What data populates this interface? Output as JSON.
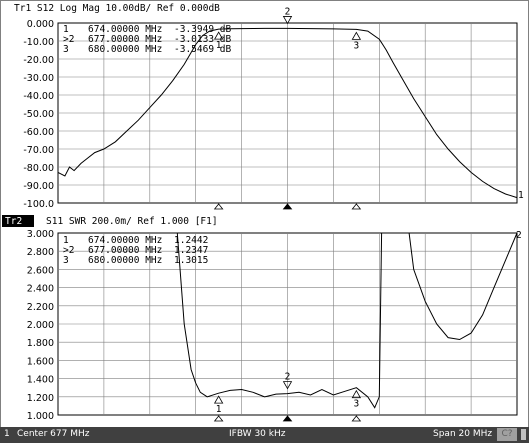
{
  "trace1": {
    "header": "Tr1  S12  Log Mag  10.00dB/  Ref 0.000dB",
    "y_tick_labels": [
      "0.000",
      "-10.00",
      "-20.00",
      "-30.00",
      "-40.00",
      "-50.00",
      "-60.00",
      "-70.00",
      "-80.00",
      "-90.00",
      "-100.0"
    ],
    "markers": [
      {
        "prefix": " ",
        "num": "1",
        "freq": "674.00000 MHz",
        "value": "-3.3949 dB"
      },
      {
        "prefix": ">",
        "num": "2",
        "freq": "677.00000 MHz",
        "value": "-3.0133 dB"
      },
      {
        "prefix": " ",
        "num": "3",
        "freq": "680.00000 MHz",
        "value": "-3.5469 dB"
      }
    ],
    "end_marker_label": "1"
  },
  "trace2": {
    "tag": "Tr2",
    "header": "S11  SWR  200.0m/  Ref 1.000  [F1]",
    "y_tick_labels": [
      "3.000",
      "2.800",
      "2.600",
      "2.400",
      "2.200",
      "2.000",
      "1.800",
      "1.600",
      "1.400",
      "1.200",
      "1.000"
    ],
    "markers": [
      {
        "prefix": " ",
        "num": "1",
        "freq": "674.00000 MHz",
        "value": "1.2442"
      },
      {
        "prefix": ">",
        "num": "2",
        "freq": "677.00000 MHz",
        "value": "1.2347"
      },
      {
        "prefix": " ",
        "num": "3",
        "freq": "680.00000 MHz",
        "value": "1.3015"
      }
    ],
    "end_marker_label": "2"
  },
  "status_bar": {
    "channel": "1",
    "center": "Center 677 MHz",
    "ifbw": "IFBW 30 kHz",
    "span": "Span 20 MHz",
    "cc": "C?"
  },
  "colors": {
    "trace": "#000000",
    "grid": "#808080",
    "background": "#ffffff",
    "status_bar": "#404040"
  },
  "chart_data": [
    {
      "type": "line",
      "title": "Tr1  S12  Log Mag  10.00dB/  Ref 0.000dB",
      "xlabel": "",
      "ylabel": "",
      "xlim": [
        667,
        687
      ],
      "ylim": [
        -100,
        0
      ],
      "grid": true,
      "series": [
        {
          "values_x": [
            667.0,
            667.3,
            667.5,
            667.7,
            668.0,
            668.3,
            668.6,
            669.0,
            669.5,
            670.0,
            670.5,
            671.0,
            671.5,
            672.0,
            672.5,
            673.0,
            673.3,
            673.6,
            674.0,
            674.5,
            675.0,
            675.5,
            676.0,
            677.0,
            678.0,
            679.0,
            680.0,
            680.5,
            681.0,
            681.3,
            681.6,
            682.0,
            682.5,
            683.0,
            683.5,
            684.0,
            684.5,
            685.0,
            685.5,
            686.0,
            686.5,
            687.0
          ],
          "values_y": [
            -83,
            -85,
            -80,
            -82,
            -78,
            -75,
            -72,
            -70,
            -66,
            -60,
            -54,
            -47,
            -40,
            -32,
            -23,
            -12,
            -7,
            -4.5,
            -3.4,
            -3.2,
            -3.1,
            -3.05,
            -3.02,
            -3.01,
            -3.1,
            -3.3,
            -3.55,
            -4.5,
            -9,
            -15,
            -22,
            -31,
            -42,
            -52,
            -62,
            -70,
            -77,
            -83,
            -88,
            -92,
            -95,
            -97
          ]
        }
      ]
    },
    {
      "type": "line",
      "title": "S11  SWR  200.0m/  Ref 1.000  [F1]",
      "xlabel": "",
      "ylabel": "",
      "xlim": [
        667,
        687
      ],
      "ylim": [
        1.0,
        3.0
      ],
      "grid": true,
      "series": [
        {
          "values_x": [
            672.2,
            672.5,
            672.8,
            673.0,
            673.2,
            673.5,
            674.0,
            674.5,
            675.0,
            675.5,
            676.0,
            676.5,
            677.0,
            677.5,
            678.0,
            678.5,
            679.0,
            679.5,
            680.0,
            680.5,
            680.8,
            681.0,
            681.1,
            682.3,
            682.5,
            683.0,
            683.5,
            684.0,
            684.5,
            685.0,
            685.5,
            686.0,
            686.5,
            687.0
          ],
          "values_y": [
            3.0,
            2.0,
            1.5,
            1.35,
            1.25,
            1.2,
            1.24,
            1.27,
            1.28,
            1.25,
            1.2,
            1.23,
            1.235,
            1.25,
            1.22,
            1.28,
            1.22,
            1.26,
            1.3,
            1.2,
            1.08,
            1.2,
            3.0,
            3.0,
            2.6,
            2.25,
            2.0,
            1.85,
            1.83,
            1.9,
            2.1,
            2.4,
            2.7,
            3.0
          ]
        }
      ]
    }
  ]
}
